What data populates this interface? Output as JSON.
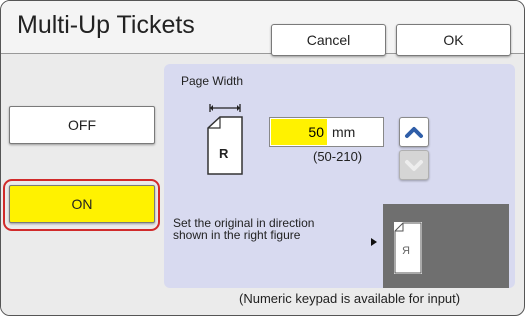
{
  "title": "Multi-Up Tickets",
  "buttons": {
    "cancel": "Cancel",
    "ok": "OK",
    "off": "OFF",
    "on": "ON"
  },
  "page_width": {
    "label": "Page Width",
    "value": "50",
    "unit": "mm",
    "range": "(50-210)",
    "page_letter": "R"
  },
  "instruction": "Set the original in direction shown in the right figure",
  "preview_letter": "R",
  "note": "(Numeric keypad is available for input)",
  "colors": {
    "selected": "#fff200",
    "highlight_border": "#d12a2a",
    "panel": "#d8daf0",
    "accent": "#2f5ea8"
  },
  "icons": {
    "page": "page-with-folded-corner-icon",
    "width_measure": "width-measure-icon",
    "increment": "chevron-up-icon",
    "decrement": "chevron-down-icon",
    "pointer": "triangle-right-icon"
  }
}
